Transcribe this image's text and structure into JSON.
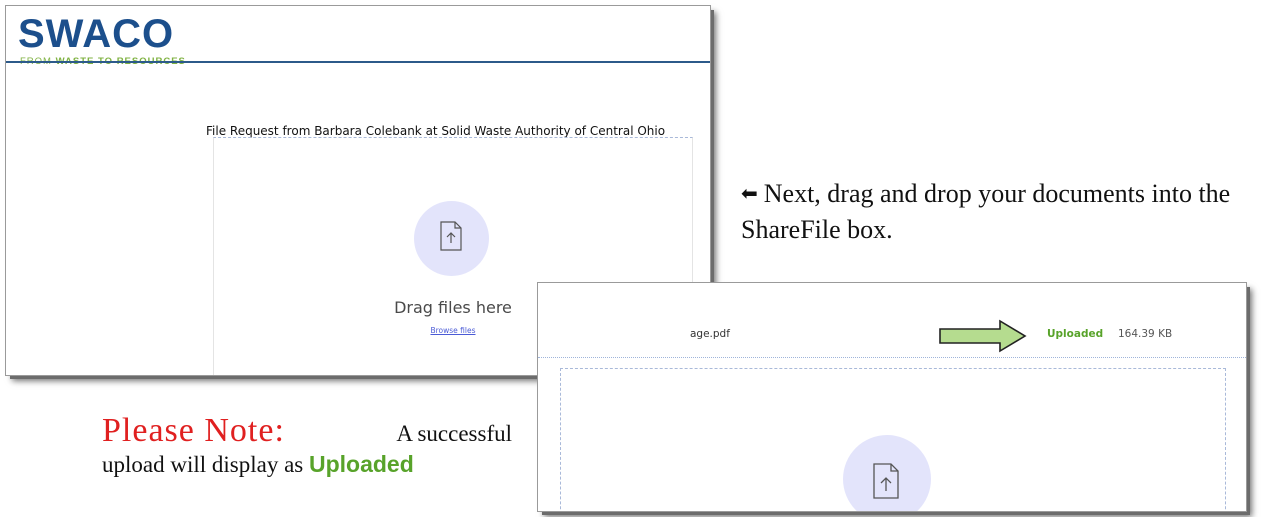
{
  "screenshot1": {
    "logo": {
      "word": "SWACO",
      "tagline_prefix": "FROM ",
      "tagline_bold": "WASTE TO RESOURCES"
    },
    "request_title": "File Request from Barbara Colebank at Solid Waste Authority of Central Ohio",
    "dropzone": {
      "icon": "upload-file-icon",
      "drag_text": "Drag files here",
      "browse_text": "Browse files"
    }
  },
  "instruction": {
    "arrow_icon": "left-arrow-icon",
    "text": "Next, drag and drop your documents into the ShareFile box."
  },
  "screenshot2": {
    "file_name": "age.pdf",
    "pointer_icon": "green-right-arrow-icon",
    "status": "Uploaded",
    "file_size": "164.39 KB",
    "dropzone_icon": "upload-file-icon"
  },
  "note": {
    "label": "Please Note:",
    "line1_rest": "A successful",
    "line2_start": "upload will display as",
    "status_word": "Uploaded"
  },
  "colors": {
    "brand_blue": "#1c4f8c",
    "brand_green": "#7fb241",
    "status_green": "#58a32a",
    "note_red": "#e02020",
    "circle_lavender": "#e3e4fb",
    "link_blue": "#4b5bd6"
  }
}
